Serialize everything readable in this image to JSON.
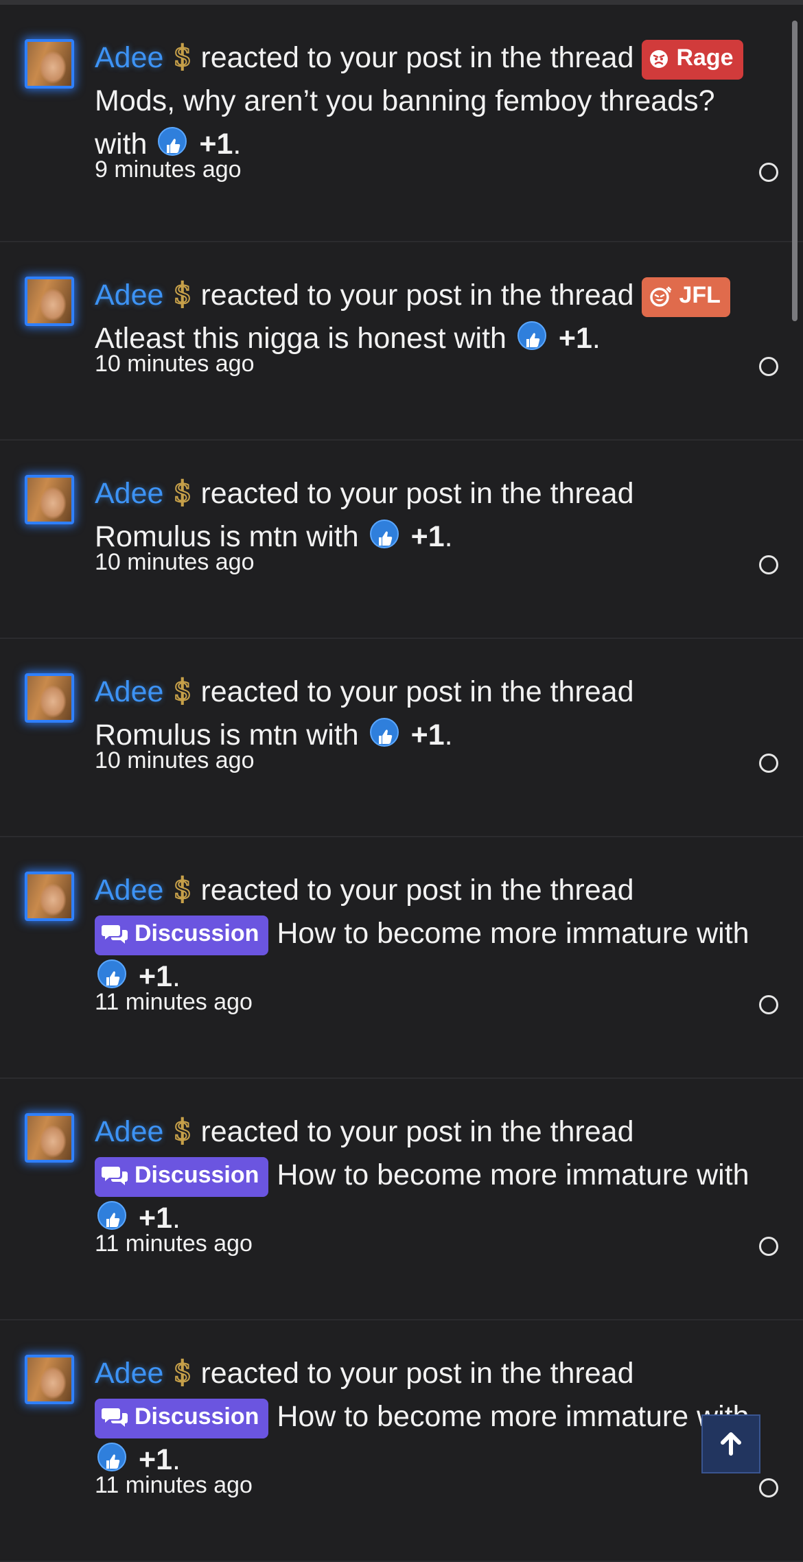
{
  "alerts": [
    {
      "username": "Adee",
      "action": "reacted to your post in the thread",
      "prefix": {
        "label": "Rage",
        "style": "rage",
        "icon": "angry-face-icon"
      },
      "thread": "Mods, why aren’t you banning femboy threads?",
      "with_text": "with",
      "reaction_icon": "thumbs-up-icon",
      "reaction": "+1",
      "period": ".",
      "time": "9 minutes ago"
    },
    {
      "username": "Adee",
      "action": "reacted to your post in the thread",
      "prefix": {
        "label": "JFL",
        "style": "jfl",
        "icon": "laughing-face-icon"
      },
      "thread": "Atleast this nigga is honest",
      "with_text": "with",
      "reaction_icon": "thumbs-up-icon",
      "reaction": "+1",
      "period": ".",
      "time": "10 minutes ago"
    },
    {
      "username": "Adee",
      "action": "reacted to your post in the thread",
      "prefix": null,
      "thread": "Romulus is mtn",
      "with_text": "with",
      "reaction_icon": "thumbs-up-icon",
      "reaction": "+1",
      "period": ".",
      "time": "10 minutes ago"
    },
    {
      "username": "Adee",
      "action": "reacted to your post in the thread",
      "prefix": null,
      "thread": "Romulus is mtn",
      "with_text": "with",
      "reaction_icon": "thumbs-up-icon",
      "reaction": "+1",
      "period": ".",
      "time": "10 minutes ago"
    },
    {
      "username": "Adee",
      "action": "reacted to your post in the thread",
      "prefix": {
        "label": "Discussion",
        "style": "discussion",
        "icon": "chat-bubbles-icon"
      },
      "thread": "How to become more immature",
      "with_text": "with",
      "reaction_icon": "thumbs-up-icon",
      "reaction": "+1",
      "period": ".",
      "time": "11 minutes ago"
    },
    {
      "username": "Adee",
      "action": "reacted to your post in the thread",
      "prefix": {
        "label": "Discussion",
        "style": "discussion",
        "icon": "chat-bubbles-icon"
      },
      "thread": "How to become more immature",
      "with_text": "with",
      "reaction_icon": "thumbs-up-icon",
      "reaction": "+1",
      "period": ".",
      "time": "11 minutes ago"
    },
    {
      "username": "Adee",
      "action": "reacted to your post in the thread",
      "prefix": {
        "label": "Discussion",
        "style": "discussion",
        "icon": "chat-bubbles-icon"
      },
      "thread": "How to become more immature",
      "with_text": "with",
      "reaction_icon": "thumbs-up-icon",
      "reaction": "+1",
      "period": ".",
      "time": "11 minutes ago"
    }
  ],
  "user_banner_icon": "dollar-sign-icon",
  "back_to_top_icon": "arrow-up-icon",
  "colors": {
    "background": "#1f1f21",
    "username": "#3d93f5",
    "avatar_glow": "#2f80ff",
    "rage_tag": "#d13b3b",
    "jfl_tag": "#e06b4c",
    "discussion_tag": "#6b55e0",
    "dollar_gold": "#c9a24a"
  }
}
